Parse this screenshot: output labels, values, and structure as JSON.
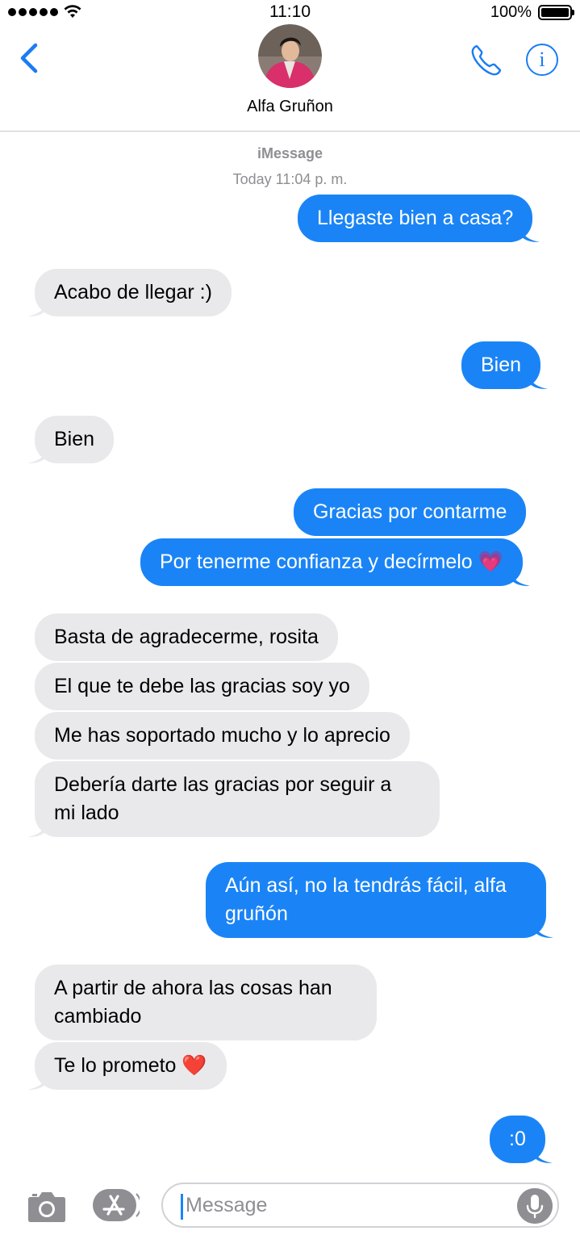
{
  "status_bar": {
    "time": "11:10",
    "battery_percent": "100%"
  },
  "header": {
    "contact_name": "Alfa Gruñon",
    "back_icon": "chevron-left-icon",
    "call_icon": "phone-icon",
    "info_icon": "info-icon",
    "info_glyph": "i",
    "accent_color": "#1a7cf4"
  },
  "conversation": {
    "service": "iMessage",
    "timestamp": "Today 11:04 p. m.",
    "messages": [
      {
        "from": "me",
        "text": "Llegaste bien a casa?"
      },
      {
        "from": "them",
        "text": "Acabo de llegar :)"
      },
      {
        "from": "me",
        "text": "Bien"
      },
      {
        "from": "them",
        "text": "Bien"
      },
      {
        "from": "me",
        "text": "Gracias por contarme"
      },
      {
        "from": "me",
        "text": "Por tenerme confianza y decírmelo 💗"
      },
      {
        "from": "them",
        "text": "Basta de agradecerme, rosita"
      },
      {
        "from": "them",
        "text": "El que te debe las gracias soy yo"
      },
      {
        "from": "them",
        "text": "Me has soportado mucho y lo aprecio"
      },
      {
        "from": "them",
        "text": "Debería darte las gracias por seguir a mi lado",
        "lines": [
          "Debería darte las gracias por seguir a",
          "mi lado"
        ]
      },
      {
        "from": "me",
        "text": "Aún así, no la tendrás fácil, alfa gruñón",
        "lines": [
          "Aún así, no la tendrás fácil, alfa",
          "gruñón"
        ]
      },
      {
        "from": "them",
        "text": "A partir de ahora las cosas han cambiado",
        "lines": [
          "A partir de ahora las cosas han",
          "cambiado"
        ]
      },
      {
        "from": "them",
        "text": "Te lo prometo ❤️"
      },
      {
        "from": "me",
        "text": ":0"
      }
    ],
    "sent_color": "#1a84f6",
    "received_color": "#e9e9eb"
  },
  "input_bar": {
    "placeholder": "Message",
    "camera_icon": "camera-icon",
    "apps_icon": "app-store-icon",
    "mic_icon": "microphone-icon"
  }
}
